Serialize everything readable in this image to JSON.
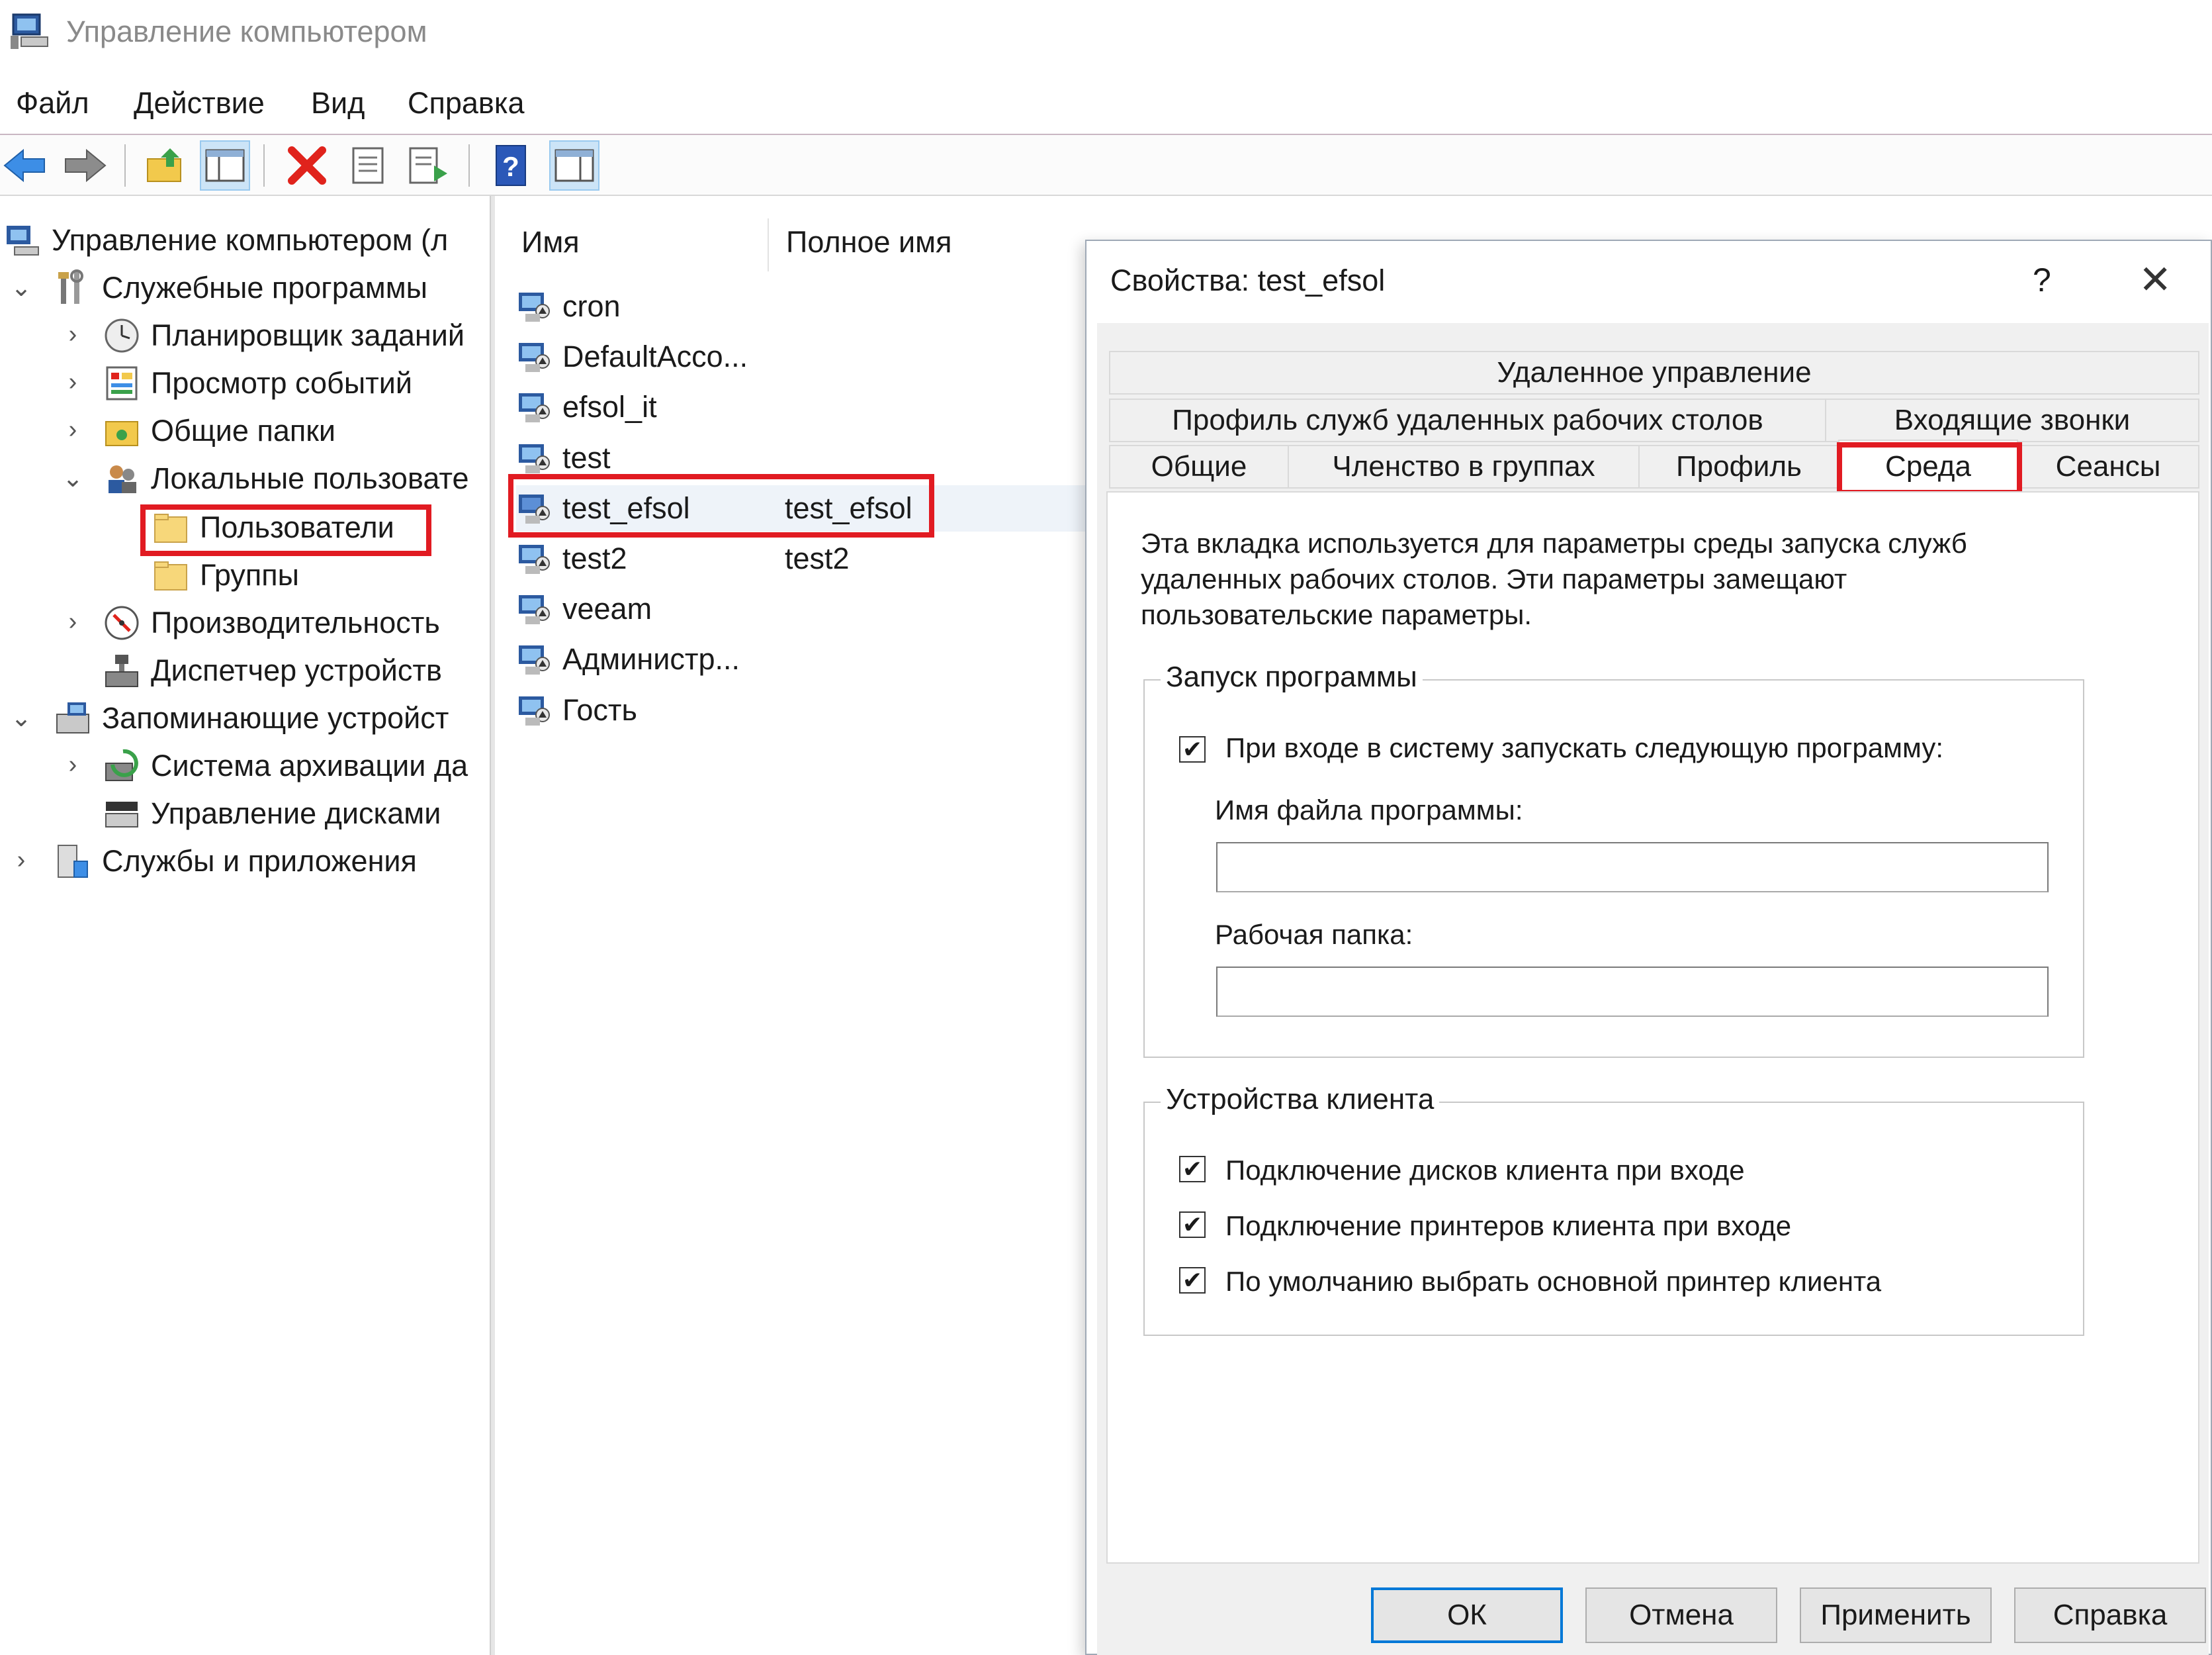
{
  "window": {
    "title": "Управление компьютером"
  },
  "menu": [
    "Файл",
    "Действие",
    "Вид",
    "Справка"
  ],
  "toolbar": {
    "buttons": [
      "back-icon",
      "forward-icon",
      "up-folder-icon",
      "show-hide-tree-icon",
      "delete-icon",
      "properties-icon",
      "export-icon",
      "help-icon",
      "show-action-pane-icon"
    ]
  },
  "tree": {
    "items": [
      {
        "label": "Управление компьютером (л"
      },
      {
        "label": "Служебные программы"
      },
      {
        "label": "Планировщик заданий"
      },
      {
        "label": "Просмотр событий"
      },
      {
        "label": "Общие папки"
      },
      {
        "label": "Локальные пользовате"
      },
      {
        "label": "Пользователи"
      },
      {
        "label": "Группы"
      },
      {
        "label": "Производительность"
      },
      {
        "label": "Диспетчер устройств"
      },
      {
        "label": "Запоминающие устройст"
      },
      {
        "label": "Система архивации да"
      },
      {
        "label": "Управление дисками"
      },
      {
        "label": "Службы и приложения"
      }
    ]
  },
  "list": {
    "columns": [
      "Имя",
      "Полное имя"
    ],
    "rows": [
      {
        "name": "cron",
        "full": ""
      },
      {
        "name": "DefaultAcco...",
        "full": ""
      },
      {
        "name": "efsol_it",
        "full": ""
      },
      {
        "name": "test",
        "full": ""
      },
      {
        "name": "test_efsol",
        "full": "test_efsol"
      },
      {
        "name": "test2",
        "full": "test2"
      },
      {
        "name": "veeam",
        "full": ""
      },
      {
        "name": "Администр...",
        "full": ""
      },
      {
        "name": "Гость",
        "full": ""
      }
    ]
  },
  "dialog": {
    "title": "Свойства: test_efsol",
    "help_glyph": "?",
    "close_glyph": "✕",
    "tabs_row1": [
      "Удаленное управление"
    ],
    "tabs_row2": [
      "Профиль служб удаленных рабочих столов",
      "Входящие звонки"
    ],
    "tabs_row3": [
      "Общие",
      "Членство в группах",
      "Профиль",
      "Среда",
      "Сеансы"
    ],
    "active_tab": "Среда",
    "description": [
      "Эта вкладка используется для параметры среды запуска служб",
      "удаленных рабочих столов. Эти параметры замещают",
      "пользовательские параметры."
    ],
    "startup_group": {
      "legend": "Запуск программы",
      "checkbox_label": "При входе в систему запускать следующую программу:",
      "checked": true,
      "program_label": "Имя файла программы:",
      "program_value": "",
      "folder_label": "Рабочая папка:",
      "folder_value": ""
    },
    "devices_group": {
      "legend": "Устройства клиента",
      "options": [
        {
          "label": "Подключение дисков клиента при входе",
          "checked": true
        },
        {
          "label": "Подключение принтеров клиента при входе",
          "checked": true
        },
        {
          "label": "По умолчанию выбрать основной принтер клиента",
          "checked": true
        }
      ]
    },
    "buttons": {
      "ok": "ОК",
      "cancel": "Отмена",
      "apply": "Применить",
      "help": "Справка"
    }
  },
  "colors": {
    "highlight": "#e11b22",
    "accent": "#0078d7"
  }
}
